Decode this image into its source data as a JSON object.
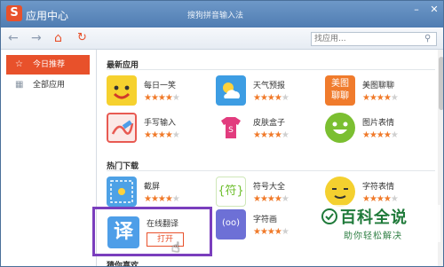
{
  "window": {
    "app_name": "应用中心",
    "title": "搜狗拼音输入法",
    "minimize": "–",
    "close": "✕"
  },
  "toolbar": {
    "search_placeholder": "找应用..."
  },
  "sidebar": {
    "items": [
      {
        "label": "今日推荐",
        "icon": "star-icon",
        "active": true
      },
      {
        "label": "全部应用",
        "icon": "grid-icon",
        "active": false
      }
    ]
  },
  "sections": {
    "latest": {
      "title": "最新应用"
    },
    "hot": {
      "title": "热门下载"
    },
    "guess": {
      "title": "猜你喜欢"
    }
  },
  "latest_apps": [
    {
      "name": "每日一笑",
      "rating": 4,
      "color": "#f6d12e",
      "icon": "smile-face-icon"
    },
    {
      "name": "天气预报",
      "rating": 4,
      "color": "#3d9de3",
      "icon": "weather-icon"
    },
    {
      "name": "美图聊聊",
      "rating": 4,
      "color": "#f07b2c",
      "icon": "meitu-icon",
      "icon_text": "美图\n聊聊"
    },
    {
      "name": "手写输入",
      "rating": 4,
      "color": "#e85a52",
      "icon": "handwrite-icon"
    },
    {
      "name": "皮肤盒子",
      "rating": 4,
      "color": "#e23c7e",
      "icon": "skin-box-icon"
    },
    {
      "name": "图片表情",
      "rating": 4,
      "color": "#7bbf31",
      "icon": "emoji-face-icon"
    }
  ],
  "hot_apps": [
    {
      "name": "截屏",
      "rating": 4,
      "color": "#4da1e6",
      "icon": "screenshot-icon"
    },
    {
      "name": "符号大全",
      "rating": 4,
      "color": "#6fbf2e",
      "icon": "symbol-icon",
      "icon_text": "{符}"
    },
    {
      "name": "字符表情",
      "rating": 4,
      "color": "#f4d02f",
      "icon": "char-emoji-icon"
    },
    {
      "name": "字符画",
      "rating": 4,
      "color": "#6d70d6",
      "icon": "char-art-icon",
      "icon_text": "(oo)"
    }
  ],
  "featured": {
    "name": "在线翻译",
    "icon_text": "译",
    "open_label": "打开",
    "color": "#4e9ee8"
  },
  "watermark": {
    "main": "百科全说",
    "sub": "助你轻松解决"
  }
}
